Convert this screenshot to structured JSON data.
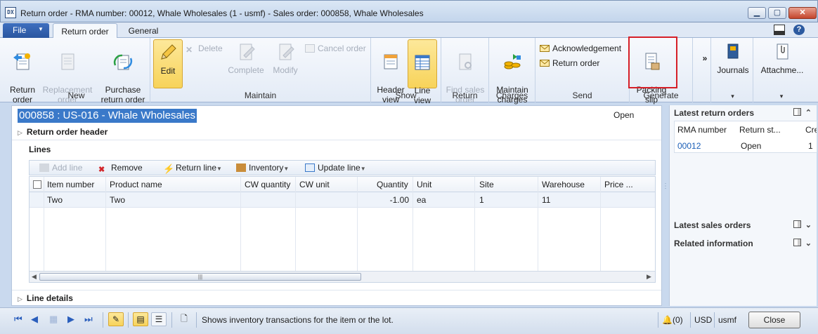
{
  "window": {
    "title": "Return order - RMA number: 00012,  Whale Wholesales (1 - usmf) - Sales order: 000858, Whale Wholesales",
    "app_icon_text": "DX"
  },
  "ribbon_tabs": {
    "file": "File",
    "tabs": [
      "Return order",
      "General"
    ],
    "active": "Return order"
  },
  "ribbon": {
    "groups": {
      "new": "New",
      "maintain": "Maintain",
      "show": "Show",
      "return": "Return",
      "charges": "Charges",
      "send": "Send",
      "generate": "Generate"
    },
    "buttons": {
      "return_order": "Return\norder",
      "replacement_order": "Replacement\norder",
      "purchase_return_order": "Purchase\nreturn order",
      "edit": "Edit",
      "delete": "Delete",
      "complete": "Complete",
      "modify": "Modify",
      "cancel_order": "Cancel order",
      "header_view": "Header\nview",
      "line_view": "Line\nview",
      "find_sales_order": "Find sales\norder",
      "maintain_charges": "Maintain\ncharges",
      "acknowledgement": "Acknowledgement",
      "send_return_order": "Return order",
      "packing_slip": "Packing\nslip",
      "more": "»",
      "journals": "Journals",
      "attachments": "Attachme..."
    }
  },
  "form": {
    "record_title": "000858 : US-016 - Whale Wholesales",
    "status": "Open",
    "fasttabs": {
      "header": "Return order header",
      "lines": "Lines",
      "line_details": "Line details"
    },
    "lines_toolbar": {
      "add_line": "Add line",
      "remove": "Remove",
      "return_line": "Return line",
      "inventory": "Inventory",
      "update_line": "Update line"
    },
    "grid": {
      "columns": [
        "Item number",
        "Product name",
        "CW quantity",
        "CW unit",
        "Quantity",
        "Unit",
        "Site",
        "Warehouse",
        "Price ..."
      ],
      "rows": [
        {
          "item_number": "Two",
          "product_name": "Two",
          "cw_quantity": "",
          "cw_unit": "",
          "quantity": "-1.00",
          "unit": "ea",
          "site": "1",
          "warehouse": "11",
          "price": ""
        }
      ]
    }
  },
  "factboxes": {
    "latest_return_orders": {
      "title": "Latest return orders",
      "columns": [
        "RMA number",
        "Return st...",
        "Cre"
      ],
      "rows": [
        {
          "rma": "00012",
          "status": "Open",
          "cre": "1"
        }
      ]
    },
    "latest_sales_orders": {
      "title": "Latest sales orders"
    },
    "related_information": {
      "title": "Related information"
    }
  },
  "statusbar": {
    "message": "Shows inventory transactions for the item or the lot.",
    "notifications": "(0)",
    "currency": "USD",
    "company": "usmf",
    "close": "Close"
  }
}
